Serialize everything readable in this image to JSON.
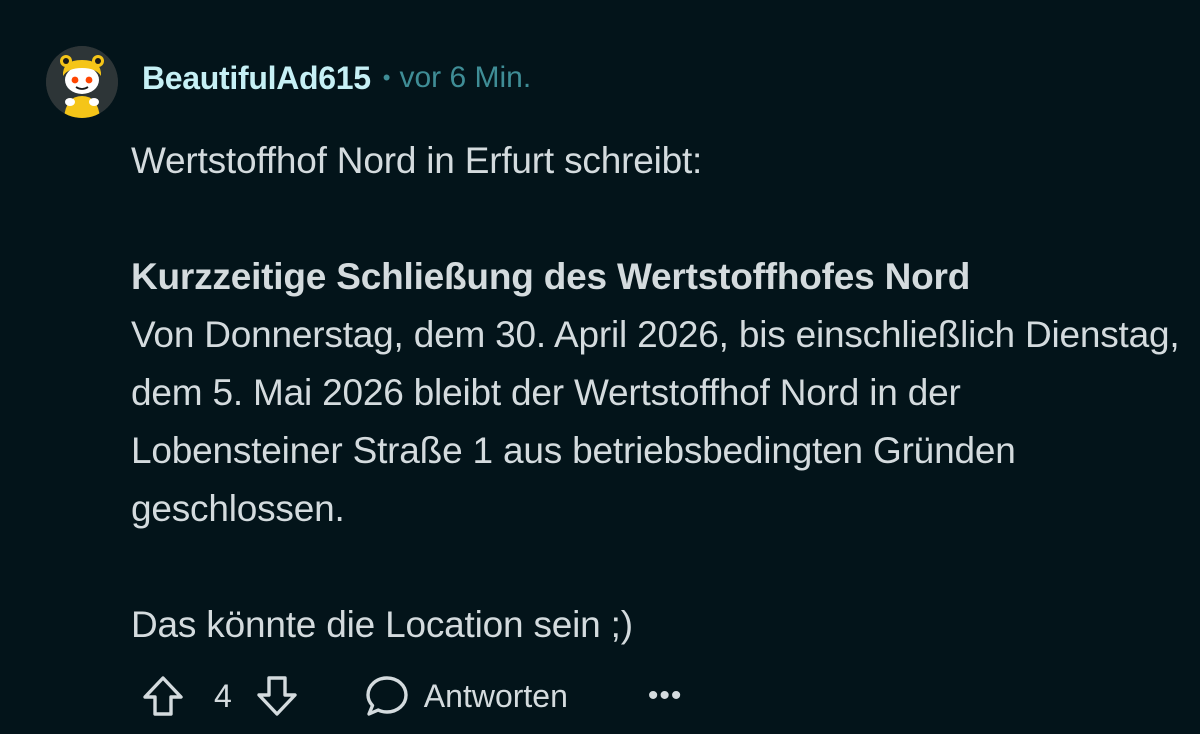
{
  "comment": {
    "author": "BeautifulAd615",
    "separator": "•",
    "time": "vor 6 Min.",
    "paragraph1": "Wertstoffhof Nord in Erfurt schreibt:",
    "headline": "Kurzzeitige Schließung des Wertstoffhofes Nord",
    "paragraph2": "Von Donnerstag, dem 30. April 2026, bis einschließlich Dienstag, dem 5. Mai 2026 bleibt der Wertstoffhof Nord in der Lobensteiner Straße 1 aus betriebsbedingten Gründen geschlossen.",
    "paragraph3": "Das könnte die Location sein ;)"
  },
  "actions": {
    "upvote_icon": "upvote-arrow-icon",
    "vote_count": "4",
    "downvote_icon": "downvote-arrow-icon",
    "reply_icon": "speech-bubble-icon",
    "reply_label": "Antworten",
    "more_label": "•••"
  },
  "colors": {
    "background": "#03141a",
    "username": "#c6f0f5",
    "timestamp": "#3f8d96",
    "text": "#d4dbde"
  }
}
